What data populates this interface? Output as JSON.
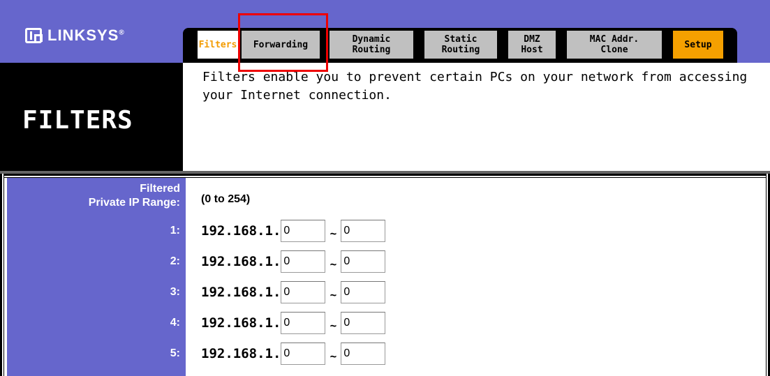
{
  "brand": {
    "logo_text": "LINKSYS",
    "trademark": "®"
  },
  "tabs": [
    {
      "label": "Filters",
      "active": true
    },
    {
      "label": "Forwarding"
    },
    {
      "label_line1": "Dynamic",
      "label_line2": "Routing"
    },
    {
      "label_line1": "Static",
      "label_line2": "Routing"
    },
    {
      "label_line1": "DMZ",
      "label_line2": "Host"
    },
    {
      "label_line1": "MAC Addr.",
      "label_line2": "Clone"
    },
    {
      "label": "Setup"
    }
  ],
  "page": {
    "title": "FILTERS",
    "description": "Filters enable you to prevent certain PCs on your network from accessing your Internet connection."
  },
  "filtered_range": {
    "label_line1": "Filtered",
    "label_line2": "Private IP Range:",
    "note": "(0 to 254)",
    "prefix": "192.168.1.",
    "separator": "~",
    "rows": [
      {
        "label": "1:",
        "from": "0",
        "to": "0"
      },
      {
        "label": "2:",
        "from": "0",
        "to": "0"
      },
      {
        "label": "3:",
        "from": "0",
        "to": "0"
      },
      {
        "label": "4:",
        "from": "0",
        "to": "0"
      },
      {
        "label": "5:",
        "from": "0",
        "to": "0"
      }
    ]
  },
  "colors": {
    "banner": "#6666cc",
    "active_tab_text": "#f39b00",
    "setup_tab": "#f5a000",
    "highlight": "#ee0000"
  }
}
